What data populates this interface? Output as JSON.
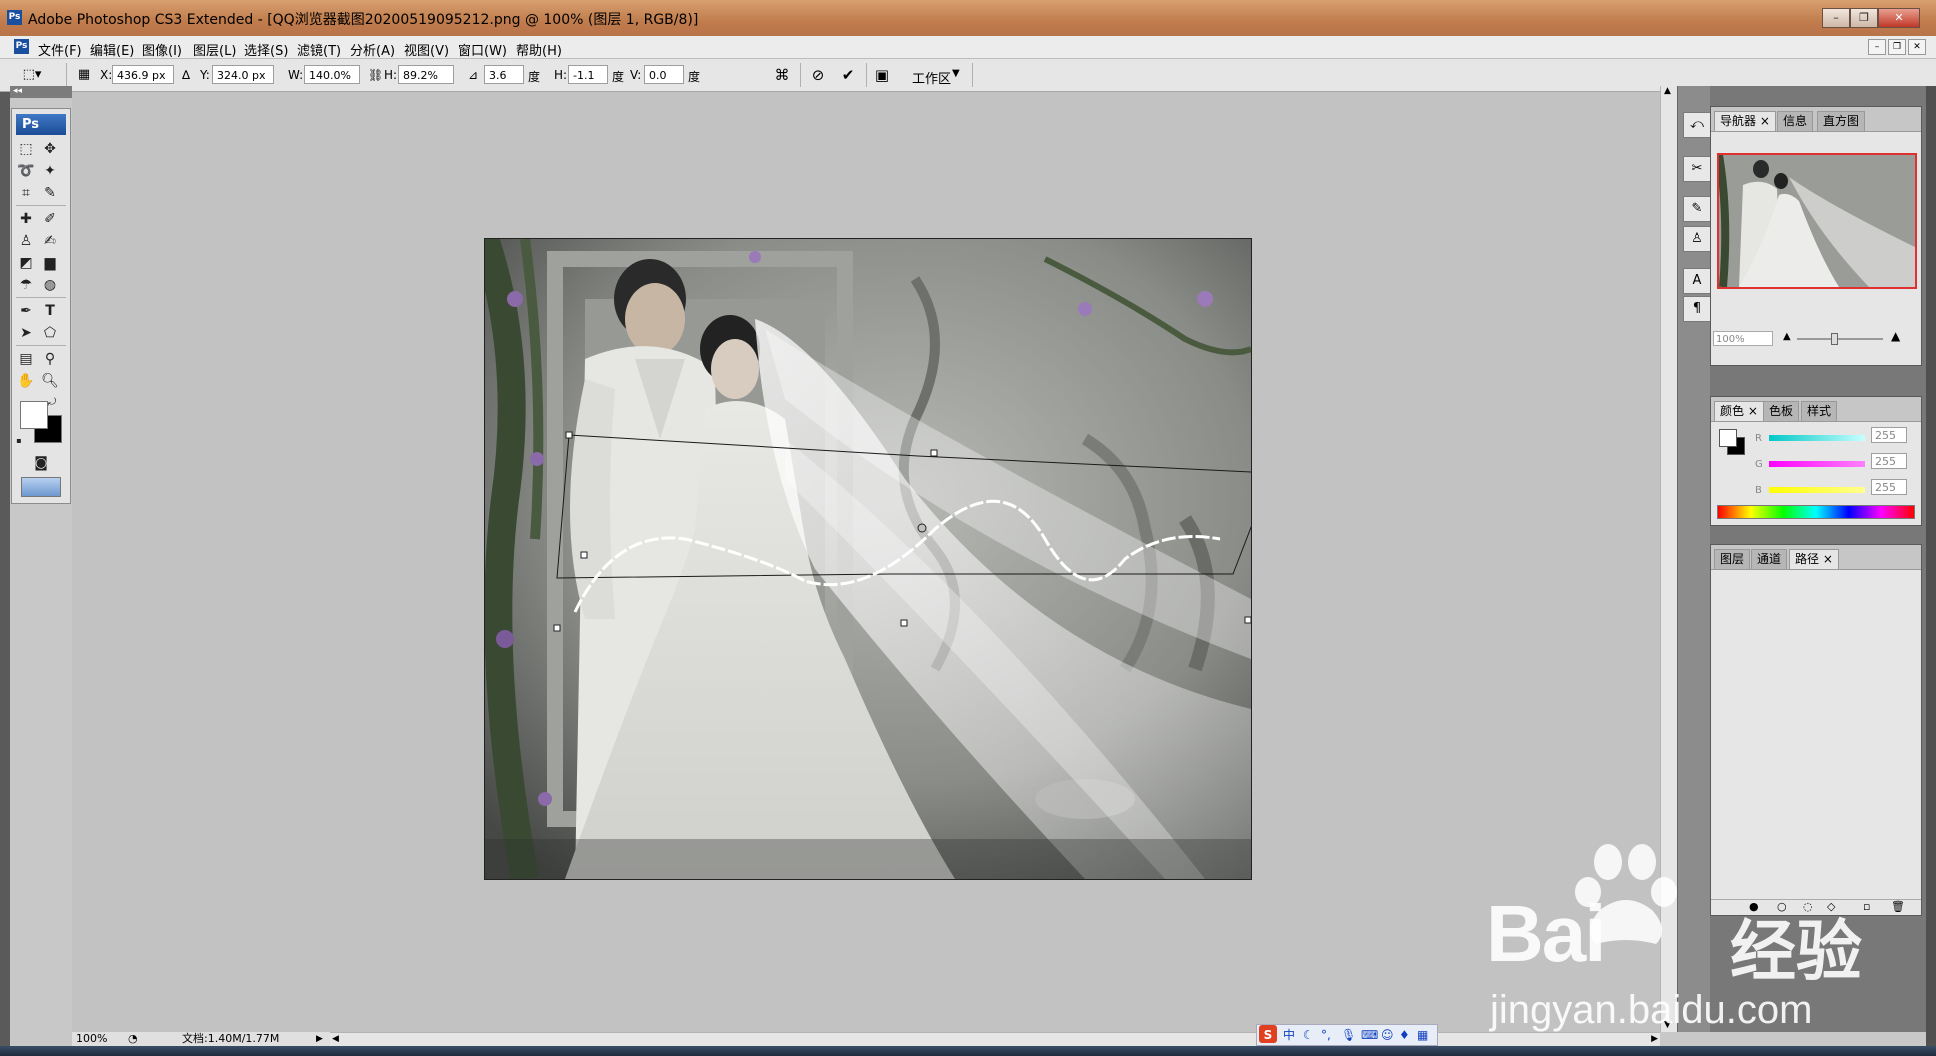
{
  "window": {
    "title": "Adobe Photoshop CS3 Extended - [QQ浏览器截图20200519095212.png @ 100% (图层 1, RGB/8)]",
    "app_icon": "Ps",
    "controls": [
      "minimize",
      "restore",
      "close"
    ]
  },
  "menu": {
    "items": [
      "文件(F)",
      "编辑(E)",
      "图像(I)",
      "图层(L)",
      "选择(S)",
      "滤镜(T)",
      "分析(A)",
      "视图(V)",
      "窗口(W)",
      "帮助(H)"
    ]
  },
  "options": {
    "x_label": "X:",
    "x_value": "436.9 px",
    "y_label": "Y:",
    "y_value": "324.0 px",
    "w_label": "W:",
    "w_value": "140.0%",
    "h_label": "H:",
    "h_value": "89.2%",
    "angle_value": "3.6",
    "angle_unit": "度",
    "hskew_label": "H:",
    "hskew_value": "-1.1",
    "hskew_unit": "度",
    "vskew_label": "V:",
    "vskew_value": "0.0",
    "vskew_unit": "度",
    "workspace_label": "工作区"
  },
  "toolbox": {
    "logo": "Ps",
    "tools": [
      "marquee-icon",
      "move-icon",
      "lasso-icon",
      "magic-wand-icon",
      "crop-icon",
      "slice-icon",
      "healing-icon",
      "brush-icon",
      "clone-stamp-icon",
      "history-brush-icon",
      "eraser-icon",
      "gradient-icon",
      "blur-icon",
      "dodge-icon",
      "pen-icon",
      "type-icon",
      "path-select-icon",
      "shape-icon",
      "notes-icon",
      "eyedropper-icon",
      "hand-icon",
      "zoom-icon"
    ],
    "foreground_color": "#ffffff",
    "background_color": "#000000"
  },
  "status": {
    "zoom": "100%",
    "doc_info": "文档:1.40M/1.77M"
  },
  "navigator": {
    "tabs": [
      "导航器",
      "信息",
      "直方图"
    ],
    "zoom": "100%"
  },
  "color_panel": {
    "tabs": [
      "颜色",
      "色板",
      "样式"
    ],
    "r_label": "R",
    "r_value": "255",
    "g_label": "G",
    "g_value": "255",
    "b_label": "B",
    "b_value": "255"
  },
  "layers_panel": {
    "tabs": [
      "图层",
      "通道",
      "路径"
    ]
  },
  "ime": {
    "items": [
      "中"
    ]
  },
  "watermark": {
    "brand": "Bai",
    "brand_suffix": "经验",
    "url": "jingyan.baidu.com"
  }
}
